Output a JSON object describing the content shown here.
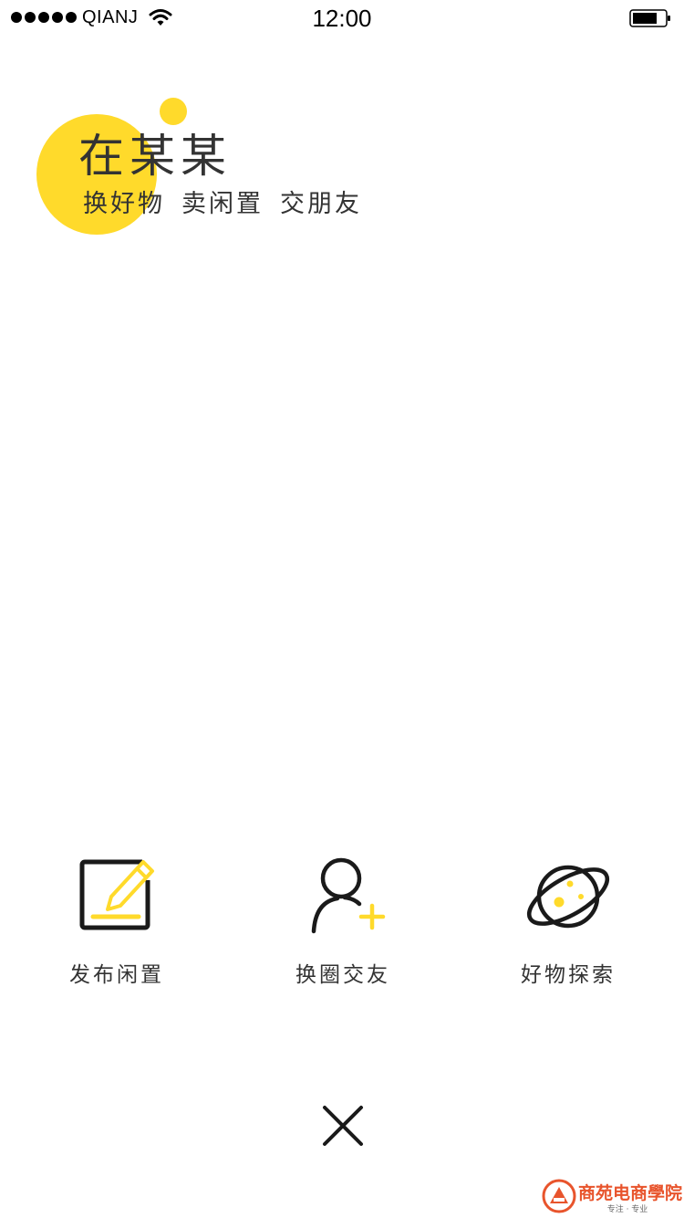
{
  "status_bar": {
    "carrier": "QIANJ",
    "time": "12:00"
  },
  "brand": {
    "title": "在某某",
    "slogan_items": [
      "换好物",
      "卖闲置",
      "交朋友"
    ],
    "accent_color": "#FFDA2B"
  },
  "actions": [
    {
      "label": "发布闲置",
      "icon": "edit-square-icon"
    },
    {
      "label": "换圈交友",
      "icon": "add-user-icon"
    },
    {
      "label": "好物探索",
      "icon": "planet-icon"
    }
  ],
  "close": {
    "icon": "close-icon"
  },
  "watermark": {
    "title": "商苑电商學院",
    "subtitle": "专注 · 专业"
  }
}
